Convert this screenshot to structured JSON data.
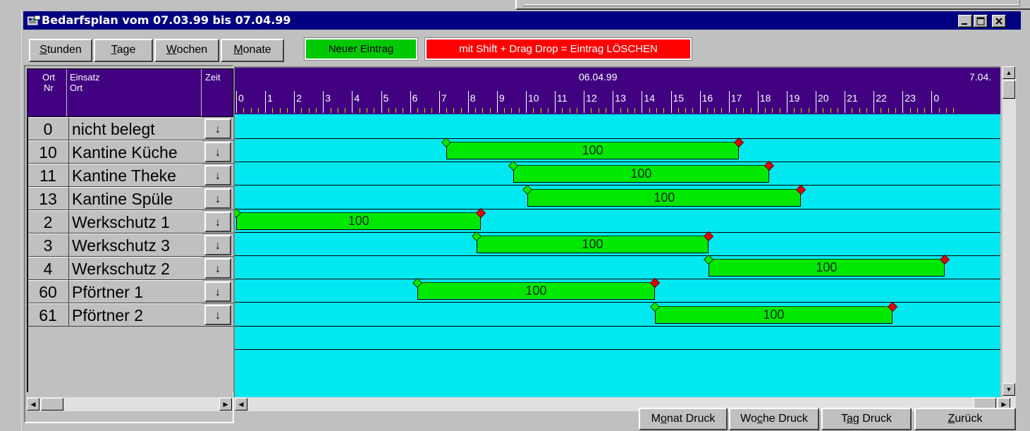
{
  "window": {
    "title": "Bedarfsplan vom 07.03.99 bis 07.04.99"
  },
  "toolbar": {
    "stunden_pre": "",
    "stunden_key": "S",
    "stunden_post": "tunden",
    "tage_pre": "",
    "tage_key": "T",
    "tage_post": "age",
    "wochen_pre": "",
    "wochen_key": "W",
    "wochen_post": "ochen",
    "monate_pre": "",
    "monate_key": "M",
    "monate_post": "onate",
    "new_entry_label": "Neuer Eintrag",
    "delete_hint_label": "mit Shift + Drag Drop = Eintrag  LÖSCHEN"
  },
  "grid_header": {
    "ort_nr_line1": "Ort",
    "ort_nr_line2": "Nr",
    "einsatz_line1": "Einsatz",
    "einsatz_line2": "Ort",
    "zeit": "Zeit"
  },
  "rows": [
    {
      "nr": "0",
      "ort": "nicht belegt",
      "arrow": "↓"
    },
    {
      "nr": "10",
      "ort": "Kantine Küche",
      "arrow": "↓"
    },
    {
      "nr": "11",
      "ort": "Kantine Theke",
      "arrow": "↓"
    },
    {
      "nr": "13",
      "ort": "Kantine Spüle",
      "arrow": "↓"
    },
    {
      "nr": "2",
      "ort": "Werkschutz 1",
      "arrow": "↓"
    },
    {
      "nr": "3",
      "ort": "Werkschutz 3",
      "arrow": "↓"
    },
    {
      "nr": "4",
      "ort": "Werkschutz 2",
      "arrow": "↓"
    },
    {
      "nr": "60",
      "ort": "Pförtner 1",
      "arrow": "↓"
    },
    {
      "nr": "61",
      "ort": "Pförtner 2",
      "arrow": "↓"
    }
  ],
  "timeline": {
    "date": "06.04.99",
    "next_date": "7.04.",
    "hours": [
      "0",
      "1",
      "2",
      "3",
      "4",
      "5",
      "6",
      "7",
      "8",
      "9",
      "10",
      "11",
      "12",
      "13",
      "14",
      "15",
      "16",
      "17",
      "18",
      "19",
      "20",
      "21",
      "22",
      "23",
      "0"
    ]
  },
  "entries": [
    {
      "row": 1,
      "start_hour": 7.25,
      "end_hour": 17.35,
      "value": "100"
    },
    {
      "row": 2,
      "start_hour": 9.55,
      "end_hour": 18.4,
      "value": "100"
    },
    {
      "row": 3,
      "start_hour": 10.05,
      "end_hour": 19.5,
      "value": "100"
    },
    {
      "row": 4,
      "start_hour": 0.0,
      "end_hour": 8.45,
      "value": "100"
    },
    {
      "row": 5,
      "start_hour": 8.3,
      "end_hour": 16.3,
      "value": "100"
    },
    {
      "row": 6,
      "start_hour": 16.3,
      "end_hour": 24.45,
      "value": "100"
    },
    {
      "row": 7,
      "start_hour": 6.25,
      "end_hour": 14.45,
      "value": "100"
    },
    {
      "row": 8,
      "start_hour": 14.45,
      "end_hour": 22.65,
      "value": "100"
    }
  ],
  "bottom": {
    "monat_pre": "M",
    "monat_key": "o",
    "monat_post": "nat Druck",
    "woche_pre": "Wo",
    "woche_key": "c",
    "woche_post": "he Druck",
    "tag_pre": "T",
    "tag_key": "a",
    "tag_post": "g Druck",
    "zurueck_pre": "",
    "zurueck_key": "Z",
    "zurueck_post": "urück"
  }
}
